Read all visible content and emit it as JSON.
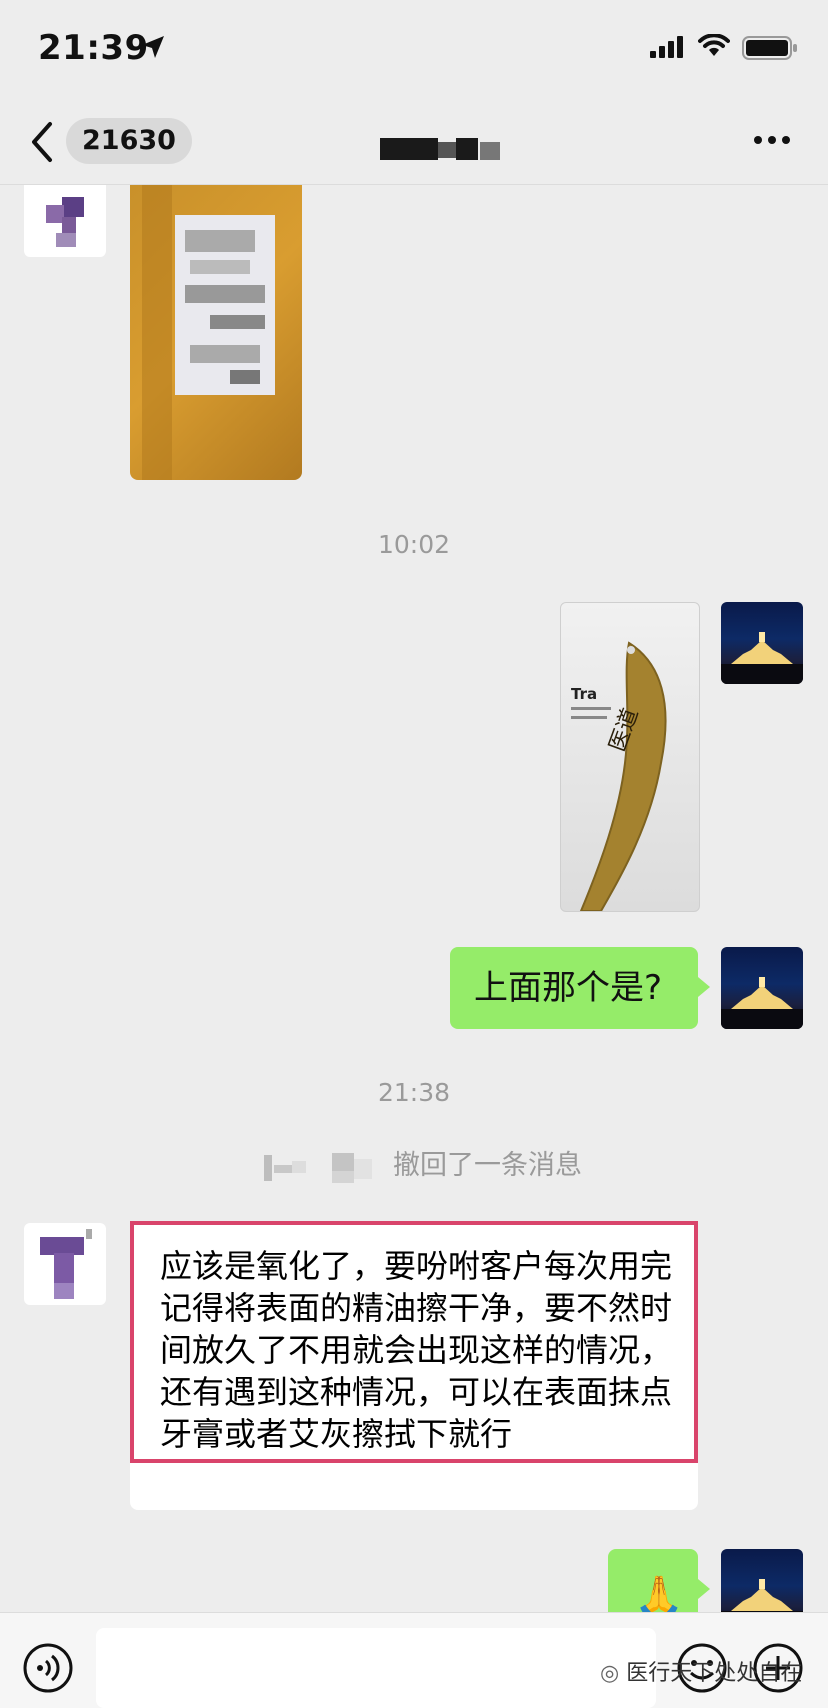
{
  "status_bar": {
    "time": "21:39"
  },
  "nav": {
    "unread_count": "21630"
  },
  "messages": {
    "timestamp_1": "10:02",
    "outgoing_text_1": "上面那个是?",
    "timestamp_2": "21:38",
    "recall_notice": "撤回了一条消息",
    "incoming_text_1": "应该是氧化了，要吩咐客户每次用完记得将表面的精油擦干净，要不然时间放久了不用就会出现这样的情况，还有遇到这种情况，可以在表面抹点牙膏或者艾灰擦拭下就行",
    "outgoing_emoji": "🙏"
  },
  "photo_2": {
    "card_text": "Tra",
    "engraving": "医道"
  },
  "watermark": "医行天下处处自在",
  "colors": {
    "accent_green": "#95ec69",
    "highlight_border": "#d9446b",
    "background": "#ededed"
  }
}
